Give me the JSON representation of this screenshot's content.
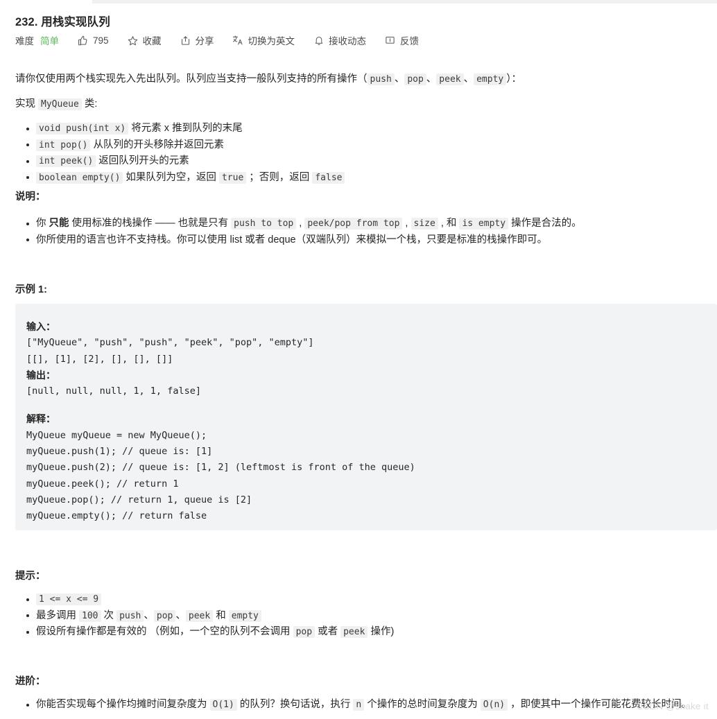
{
  "header": {
    "title": "232. 用栈实现队列",
    "meta": {
      "difficulty_label": "难度",
      "difficulty_value": "简单",
      "difficulty_color": "#5cb85c",
      "likes_count": "795",
      "favorite_label": "收藏",
      "share_label": "分享",
      "translate_label": "切换为英文",
      "subscribe_label": "接收动态",
      "feedback_label": "反馈",
      "icons": {
        "thumbs_up": "thumbs-up-icon",
        "star": "star-icon",
        "share": "share-icon",
        "translate": "translate-icon",
        "bell": "bell-icon",
        "feedback": "feedback-icon"
      }
    }
  },
  "body": {
    "intro_1": "请你仅使用两个栈实现先入先出队列。队列应当支持一般队列支持的所有操作（",
    "intro_code_1": "push",
    "intro_sep_1": "、",
    "intro_code_2": "pop",
    "intro_sep_2": "、",
    "intro_code_3": "peek",
    "intro_sep_3": "、",
    "intro_code_4": "empty",
    "intro_1_end": "）：",
    "intro_2_pre": "实现 ",
    "intro_2_code": "MyQueue",
    "intro_2_post": " 类:",
    "methods": [
      {
        "code": "void push(int x)",
        "text": " 将元素 x 推到队列的末尾"
      },
      {
        "code": "int pop()",
        "text": " 从队列的开头移除并返回元素"
      },
      {
        "code": "int peek()",
        "text": " 返回队列开头的元素"
      },
      {
        "code": "boolean empty()",
        "text": " 如果队列为空，返回 ",
        "code2": "true",
        "text2": " ；否则，返回 ",
        "code3": "false"
      }
    ],
    "notes_heading": "说明：",
    "note_1": {
      "pre": "你 ",
      "bold": "只能",
      "mid": " 使用标准的栈操作 —— 也就是只有 ",
      "code1": "push to top",
      "sep1": " , ",
      "code2": "peek/pop from top",
      "sep2": " , ",
      "code3": "size",
      "sep3": " , 和 ",
      "code4": "is empty",
      "post": " 操作是合法的。"
    },
    "note_2": "你所使用的语言也许不支持栈。你可以使用 list 或者 deque（双端队列）来模拟一个栈，只要是标准的栈操作即可。",
    "example_heading": "示例 1:",
    "example": {
      "input_label": "输入：",
      "input_lines": [
        "[\"MyQueue\", \"push\", \"push\", \"peek\", \"pop\", \"empty\"]",
        "[[], [1], [2], [], [], []]"
      ],
      "output_label": "输出：",
      "output_lines": [
        "[null, null, null, 1, 1, false]"
      ],
      "explain_label": "解释：",
      "explain_lines": [
        "MyQueue myQueue = new MyQueue();",
        "myQueue.push(1); // queue is: [1]",
        "myQueue.push(2); // queue is: [1, 2] (leftmost is front of the queue)",
        "myQueue.peek(); // return 1",
        "myQueue.pop(); // return 1, queue is [2]",
        "myQueue.empty(); // return false"
      ]
    },
    "hints_heading": "提示：",
    "hints": {
      "h1_code": "1 <= x <= 9",
      "h2_pre": "最多调用 ",
      "h2_code1": "100",
      "h2_mid1": " 次 ",
      "h2_code2": "push",
      "h2_sep1": "、",
      "h2_code3": "pop",
      "h2_sep2": "、",
      "h2_code4": "peek",
      "h2_mid2": " 和 ",
      "h2_code5": "empty",
      "h3_pre": "假设所有操作都是有效的 （例如，一个空的队列不会调用 ",
      "h3_code1": "pop",
      "h3_mid": " 或者 ",
      "h3_code2": "peek",
      "h3_post": " 操作)"
    },
    "advanced_heading": "进阶：",
    "advanced": {
      "pre": "你能否实现每个操作均摊时间复杂度为 ",
      "code1": "O(1)",
      "mid1": " 的队列？换句话说，执行 ",
      "code2": "n",
      "mid2": " 个操作的总时间复杂度为 ",
      "code3": "O(n)",
      "post": " ，即使其中一个操作可能花费较长时间。"
    }
  },
  "watermark": "CSDN @shake it"
}
